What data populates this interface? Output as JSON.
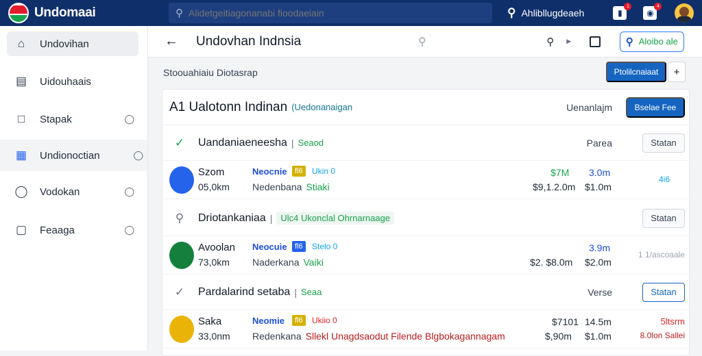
{
  "app": {
    "name": "Undomaai",
    "search_placeholder": "Alidetgeitiagonanabi fioodaeiain",
    "user_name": "Ahlibllugdeaeh",
    "notif_count": "1",
    "msg_count": "4"
  },
  "sidebar": {
    "items": [
      {
        "label": "Undovihan",
        "icon": "home-icon"
      },
      {
        "label": "Uidouhaais",
        "icon": "list-icon"
      },
      {
        "label": "Stapak",
        "icon": "box-icon"
      },
      {
        "label": "Undionoctian",
        "icon": "apps-icon"
      },
      {
        "label": "Vodokan",
        "icon": "circle-icon"
      },
      {
        "label": "Feaaga",
        "icon": "briefcase-icon"
      }
    ]
  },
  "header": {
    "title": "Undovhan Indnsia",
    "search_button": "Aloibo ale"
  },
  "subbar": {
    "breadcrumb": "Stoouahiaiu Diotasrap",
    "primary_button": "Ptolilcnaiaat",
    "plus_label": "+"
  },
  "panel": {
    "title": "A1 Ualotonn Indinan",
    "subtitle": "(Uedonanaigan",
    "label": "Uenanlajm",
    "button": "Bselae Fee"
  },
  "groups": [
    {
      "icon": "check-icon",
      "title": "Uandaniaeneesha",
      "sep": "|",
      "tag": "Seaod",
      "label": "Parea",
      "button": "Statan",
      "row": {
        "name": "Szom",
        "amount": "05,0km",
        "kind": "Neocnie",
        "chip": "fl6",
        "tagx": "Ukin 0",
        "desc": "Nedenbana",
        "desc2": "Stiaki",
        "v1a": "$7M",
        "v1b": "3.0m",
        "v2a": "$9,1.2.0m",
        "v2b": "$1.0m",
        "right": "4i6"
      }
    },
    {
      "icon": "search-icon",
      "title": "Driotankaniaa",
      "sep": "|",
      "tag": "Ulc4 Ukonclal Ohrnarnaage",
      "label": "",
      "button": "Statan",
      "row": {
        "name": "Avoolan",
        "amount": "73,0km",
        "kind": "Neocuie",
        "chip": "fl6",
        "tagx": "Stelo 0",
        "desc": "Naderkana",
        "desc2": "Vaiki",
        "v1a": "",
        "v1b": "3.9m",
        "v2a": "$2. $8.0m",
        "v2b": "$2.0m",
        "right": "1 1/ascoaale"
      }
    },
    {
      "icon": "chevron-icon",
      "title": "Pardalarind setaba",
      "sep": "|",
      "tag": "Seaa",
      "label": "Verse",
      "button": "Statan",
      "row": {
        "name": "Saka",
        "amount": "33,0nm",
        "kind": "Neomie",
        "chip": "fl6",
        "tagx": "Ukiio 0",
        "desc": "Redenkana",
        "desc2": "Sllekl Unagdsaodut Filende Blgbokagannagam",
        "v1a": "$7101",
        "v1b": "14.5m",
        "v2a": "$,90m",
        "v2b": "$1.0m",
        "right_top": "5ltsrm",
        "right": "8.0lon Sallei"
      }
    }
  ]
}
